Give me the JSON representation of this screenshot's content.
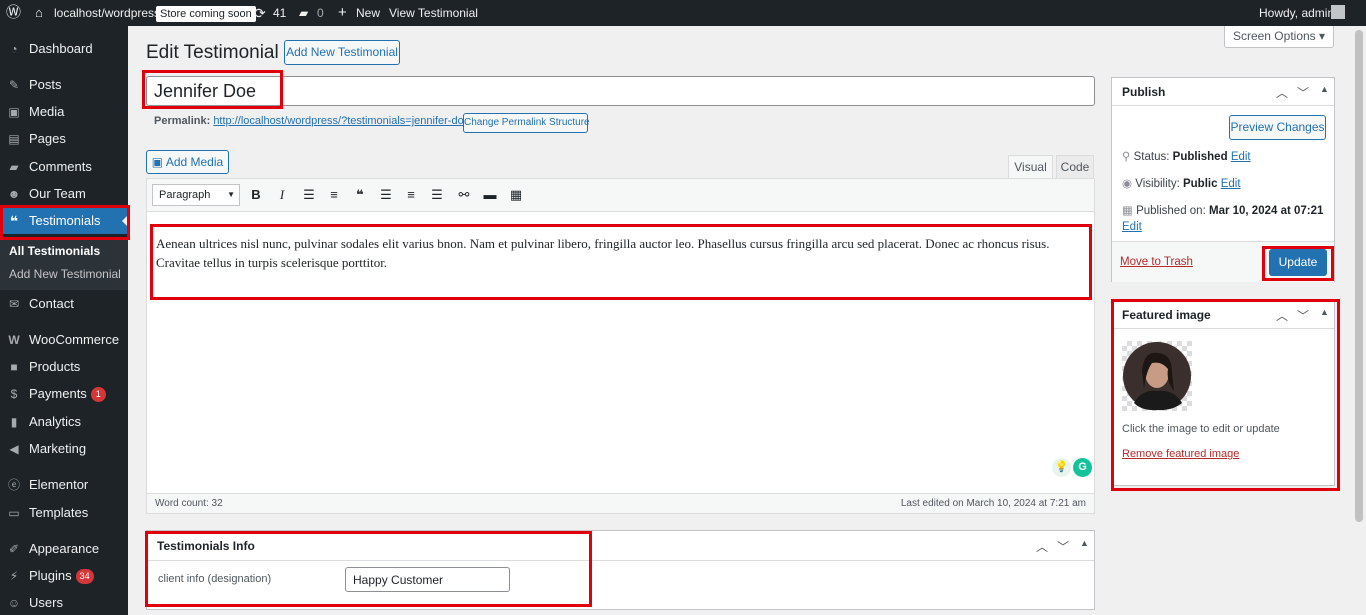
{
  "adminbar": {
    "site_name": "localhost/wordpress",
    "store_badge": "Store coming soon",
    "updates_count": "41",
    "comments_count": "0",
    "new_label": "New",
    "view_label": "View Testimonial",
    "howdy": "Howdy, admin"
  },
  "sidebar": {
    "items": [
      {
        "label": "Dashboard",
        "icon": "dashboard-icon"
      },
      {
        "label": "Posts",
        "icon": "pin-icon"
      },
      {
        "label": "Media",
        "icon": "media-icon"
      },
      {
        "label": "Pages",
        "icon": "pages-icon"
      },
      {
        "label": "Comments",
        "icon": "comments-icon"
      },
      {
        "label": "Our Team",
        "icon": "team-icon"
      },
      {
        "label": "Testimonials",
        "icon": "quote-icon"
      },
      {
        "label": "Contact",
        "icon": "mail-icon"
      },
      {
        "label": "WooCommerce",
        "icon": "woo-icon"
      },
      {
        "label": "Products",
        "icon": "box-icon"
      },
      {
        "label": "Payments",
        "icon": "payments-icon",
        "badge": "1"
      },
      {
        "label": "Analytics",
        "icon": "bar-chart-icon"
      },
      {
        "label": "Marketing",
        "icon": "megaphone-icon"
      },
      {
        "label": "Elementor",
        "icon": "elementor-icon"
      },
      {
        "label": "Templates",
        "icon": "folder-icon"
      },
      {
        "label": "Appearance",
        "icon": "brush-icon"
      },
      {
        "label": "Plugins",
        "icon": "plug-icon",
        "badge": "34"
      },
      {
        "label": "Users",
        "icon": "user-icon"
      }
    ],
    "submenu": {
      "all": "All Testimonials",
      "add_new": "Add New Testimonial"
    }
  },
  "screen_options": "Screen Options ▾",
  "page": {
    "title": "Edit Testimonial",
    "add_new_button": "Add New Testimonial",
    "post_title": "Jennifer Doe",
    "permalink_label": "Permalink:",
    "permalink_url": "http://localhost/wordpress/?testimonials=jennifer-doe",
    "change_permalink": "Change Permalink Structure"
  },
  "editor": {
    "add_media": "Add Media",
    "tab_visual": "Visual",
    "tab_code": "Code",
    "format_select": "Paragraph",
    "content": "Aenean ultrices nisl nunc, pulvinar sodales elit varius bnon. Nam et pulvinar libero, fringilla auctor leo. Phasellus cursus fringilla arcu sed placerat. Donec ac rhoncus risus. Cravitae tellus in turpis scelerisque porttitor.",
    "word_count": "Word count: 32",
    "last_edited": "Last edited on March 10, 2024 at 7:21 am"
  },
  "publish": {
    "title": "Publish",
    "preview": "Preview Changes",
    "status_label": "Status:",
    "status_value": "Published",
    "visibility_label": "Visibility:",
    "visibility_value": "Public",
    "published_on_label": "Published on:",
    "published_on_value": "Mar 10, 2024 at 07:21",
    "edit": "Edit",
    "trash": "Move to Trash",
    "update": "Update"
  },
  "featured": {
    "title": "Featured image",
    "hint": "Click the image to edit or update",
    "remove": "Remove featured image"
  },
  "testimonials_info": {
    "title": "Testimonials Info",
    "field_label": "client info (designation)",
    "field_value": "Happy Customer"
  },
  "colors": {
    "accent": "#2271b1",
    "sidebar": "#1d2327",
    "highlight": "#e0000b"
  }
}
